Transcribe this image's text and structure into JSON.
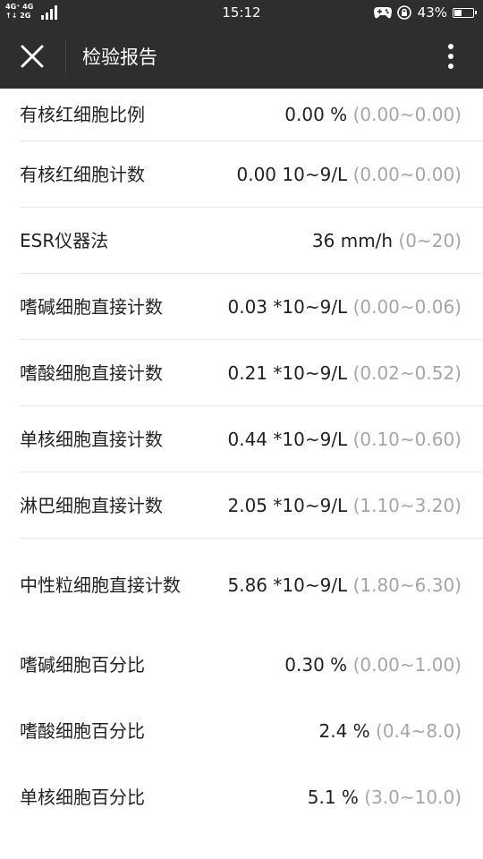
{
  "status_bar": {
    "network_top": "4G⁺ 4G",
    "network_bottom": "↑↓ 2G",
    "time": "15:12",
    "battery": "43%",
    "battery_level": 0.43,
    "icons": [
      "signal-icon",
      "game-controller-icon",
      "rotation-lock-icon",
      "battery-icon"
    ]
  },
  "app_bar": {
    "title": "检验报告",
    "close_icon": "close-icon",
    "more_icon": "more-vertical-icon"
  },
  "report": {
    "items": [
      {
        "name": "有核红细胞比例",
        "value": "0.00 %",
        "range": "(0.00~0.00)"
      },
      {
        "name": "有核红细胞计数",
        "value": "0.00 10~9/L",
        "range": "(0.00~0.00)"
      },
      {
        "name": "ESR仪器法",
        "value": "36 mm/h",
        "range": "(0~20)"
      },
      {
        "name": "嗜碱细胞直接计数",
        "value": "0.03 *10~9/L",
        "range": "(0.00~0.06)"
      },
      {
        "name": "嗜酸细胞直接计数",
        "value": "0.21 *10~9/L",
        "range": "(0.02~0.52)"
      },
      {
        "name": "单核细胞直接计数",
        "value": "0.44 *10~9/L",
        "range": "(0.10~0.60)"
      },
      {
        "name": "淋巴细胞直接计数",
        "value": "2.05 *10~9/L",
        "range": "(1.10~3.20)"
      },
      {
        "name": "中性粒细胞直接计数",
        "value": "5.86 *10~9/L",
        "range": "(1.80~6.30)"
      },
      {
        "name": "嗜碱细胞百分比",
        "value": "0.30 %",
        "range": "(0.00~1.00)"
      },
      {
        "name": "嗜酸细胞百分比",
        "value": "2.4 %",
        "range": "(0.4~8.0)"
      },
      {
        "name": "单核细胞百分比",
        "value": "5.1 %",
        "range": "(3.0~10.0)"
      }
    ]
  }
}
